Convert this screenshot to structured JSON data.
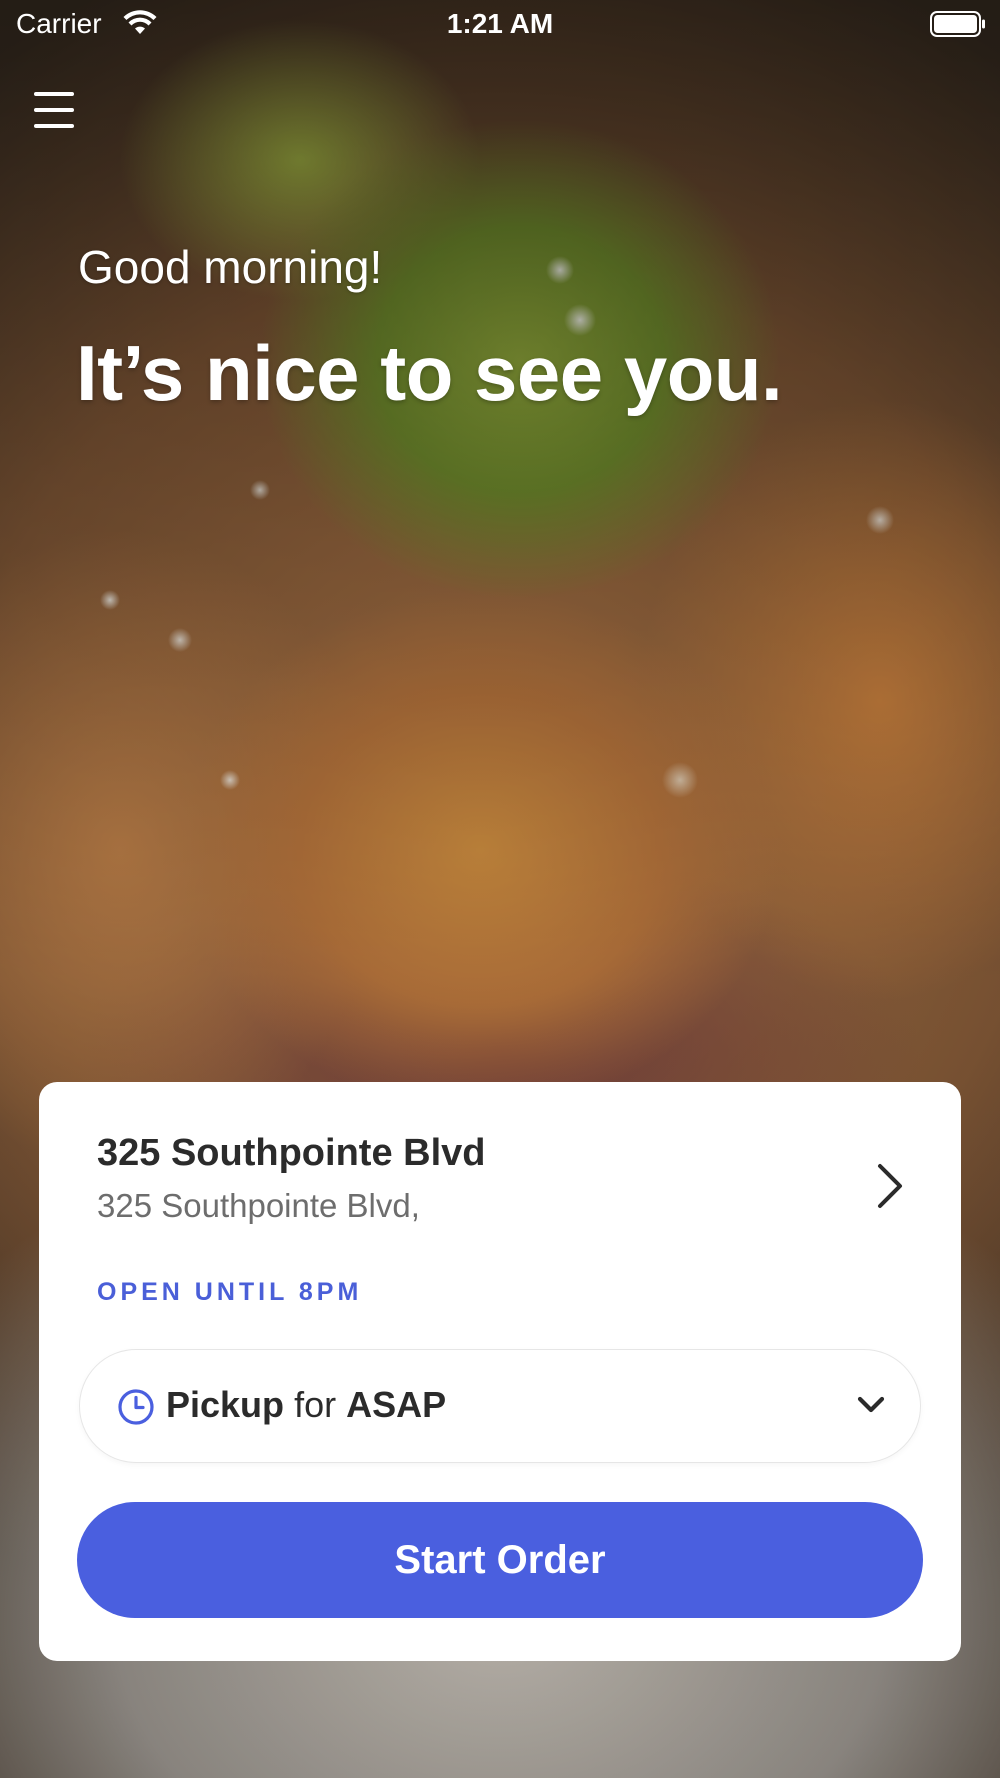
{
  "status_bar": {
    "carrier": "Carrier",
    "time": "1:21 AM"
  },
  "hero": {
    "greeting": "Good morning!",
    "headline": "It’s nice to see you."
  },
  "location": {
    "name": "325 Southpointe Blvd",
    "address": "325 Southpointe Blvd,",
    "hours_status": "OPEN UNTIL 8PM"
  },
  "order_mode": {
    "mode": "Pickup",
    "connector": "for",
    "time": "ASAP"
  },
  "actions": {
    "start_order_label": "Start Order"
  },
  "icons": {
    "menu": "hamburger-menu-icon",
    "wifi": "wifi-icon",
    "battery": "battery-icon",
    "clock": "clock-icon",
    "chevron_right": "chevron-right-icon",
    "chevron_down": "chevron-down-icon"
  },
  "colors": {
    "accent": "#4a5fdf",
    "open_status": "#4a5fd8",
    "card_bg": "#ffffff",
    "text_primary": "#2b2b2b",
    "text_secondary": "#6d6d6d"
  }
}
